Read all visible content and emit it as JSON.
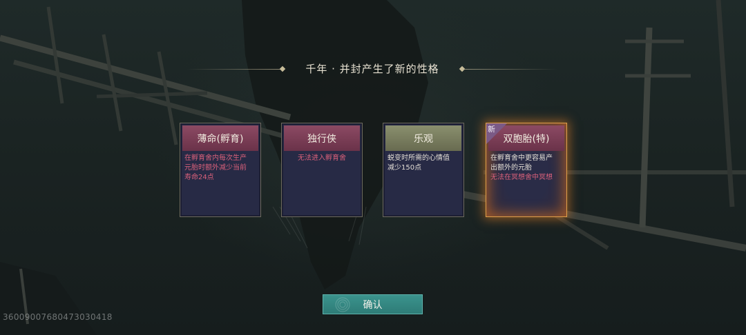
{
  "title": "千年 · 并封产生了新的性格",
  "cards": [
    {
      "name": "薄命(孵育)",
      "lines": [
        "在孵育舍内每次生产",
        "元胎时额外减少当前",
        "寿命24点"
      ],
      "line_colors": [
        "#d9607a",
        "#d9607a",
        "#d9607a"
      ]
    },
    {
      "name": "独行侠",
      "lines": [
        "无法进入孵育舍"
      ],
      "line_colors": [
        "#d9607a"
      ]
    },
    {
      "name": "乐观",
      "lines": [
        "蜕变时所需的心情值",
        "减少150点"
      ],
      "line_colors": [
        "#e3ded6",
        "#e3ded6"
      ]
    },
    {
      "name": "双胞胎(特)",
      "tag": "新",
      "lines": [
        "在孵育舍中更容易产",
        "出额外的元胎",
        "无法在冥想舍中冥想"
      ],
      "line_colors": [
        "#e3ded6",
        "#e3ded6",
        "#d9607a"
      ]
    }
  ],
  "confirm_label": "确认",
  "uid": "3600900768047303041​8",
  "colors": {
    "negative": "#d9607a",
    "positive": "#e3ded6",
    "confirm": "#33857f",
    "special_glow": "#e0a04a"
  }
}
